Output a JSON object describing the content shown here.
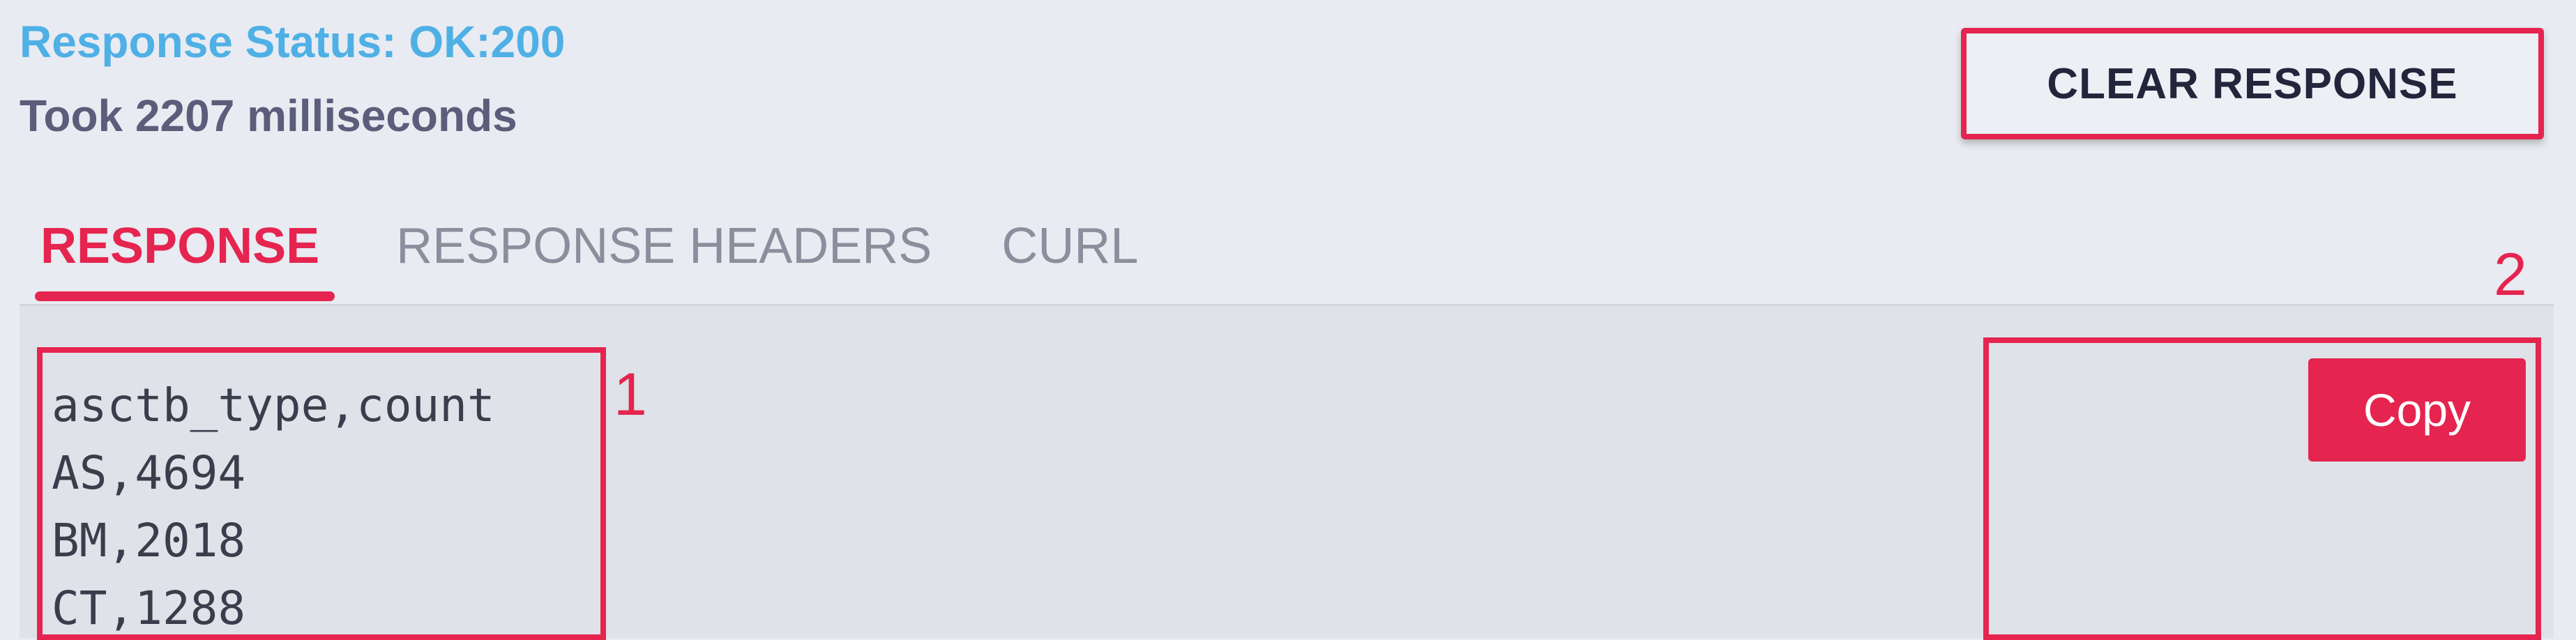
{
  "response": {
    "status_text": "Response Status: OK:200",
    "timing_text": "Took 2207 milliseconds"
  },
  "toolbar": {
    "clear_label": "CLEAR RESPONSE"
  },
  "tabs": [
    {
      "label": "RESPONSE",
      "active": true
    },
    {
      "label": "RESPONSE HEADERS",
      "active": false
    },
    {
      "label": "CURL",
      "active": false
    }
  ],
  "body": {
    "lines": [
      "asctb_type,count",
      "AS,4694",
      "BM,2018",
      "CT,1288"
    ]
  },
  "copy": {
    "label": "Copy"
  },
  "annotations": {
    "marker_1": "1",
    "marker_2": "2"
  },
  "colors": {
    "accent": "#e5254f",
    "status": "#4fb0e6",
    "background": "#e8ebf1",
    "panel": "#dfe2e8"
  }
}
